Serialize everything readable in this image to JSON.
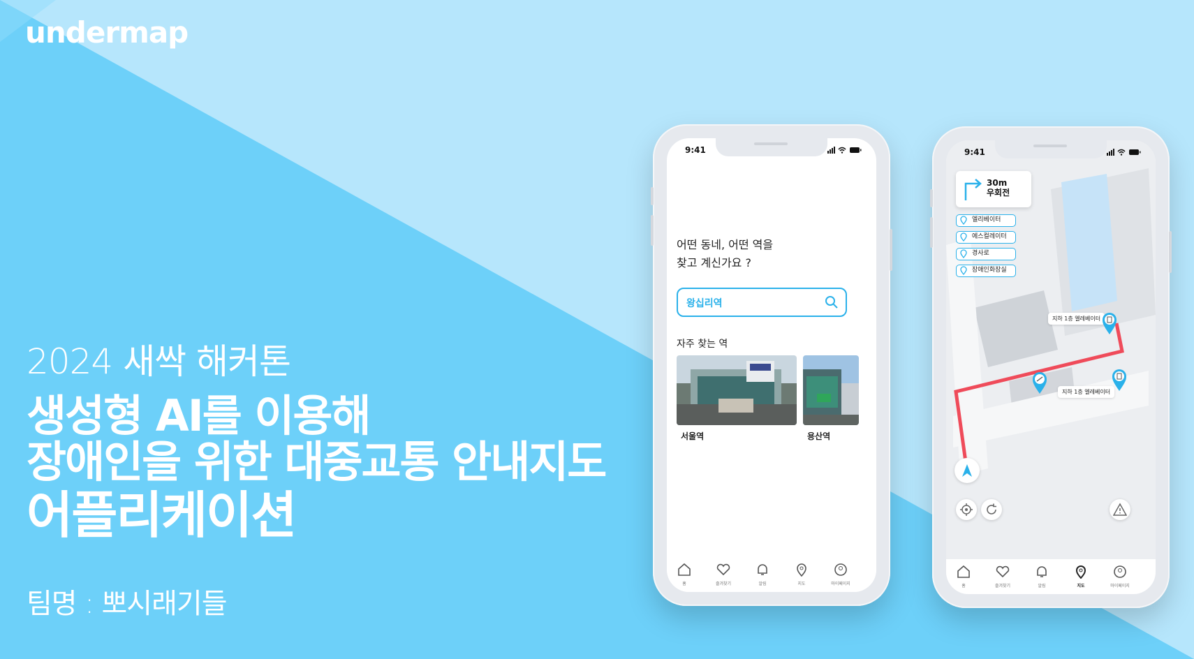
{
  "brand": "undermap",
  "hero": {
    "subtitle": "2024 새싹 해커톤",
    "headline_line1": "생성형 AI를 이용해",
    "headline_line2": "장애인을 위한 대중교통 안내지도",
    "headline_line3": "어플리케이션",
    "team": "팀명 : 뽀시래기들"
  },
  "colors": {
    "accent": "#2ab1ea",
    "route": "#ef4b5a",
    "bg_dark": "#6dd0f9",
    "bg_light": "#b6e6fc"
  },
  "phone1": {
    "time": "9:41",
    "question_line1": "어떤 동네, 어떤 역을",
    "question_line2": "찾고 계신가요 ?",
    "search_value": "왕십리역",
    "frequent_title": "자주 찾는 역",
    "stations": [
      "서울역",
      "용산역"
    ],
    "tabs": [
      "홈",
      "즐겨찾기",
      "알림",
      "지도",
      "마이페이지"
    ]
  },
  "phone2": {
    "time": "9:41",
    "turn_distance": "30m",
    "turn_direction": "우회전",
    "chips": [
      "엘리베이터",
      "에스컬레이터",
      "경사로",
      "장애인화장실"
    ],
    "map_label_1": "지하 1층 엘레베이터",
    "map_label_2": "지하 1층 엘레베이터",
    "tabs": [
      "홈",
      "즐겨찾기",
      "알림",
      "지도",
      "마이페이지"
    ]
  }
}
